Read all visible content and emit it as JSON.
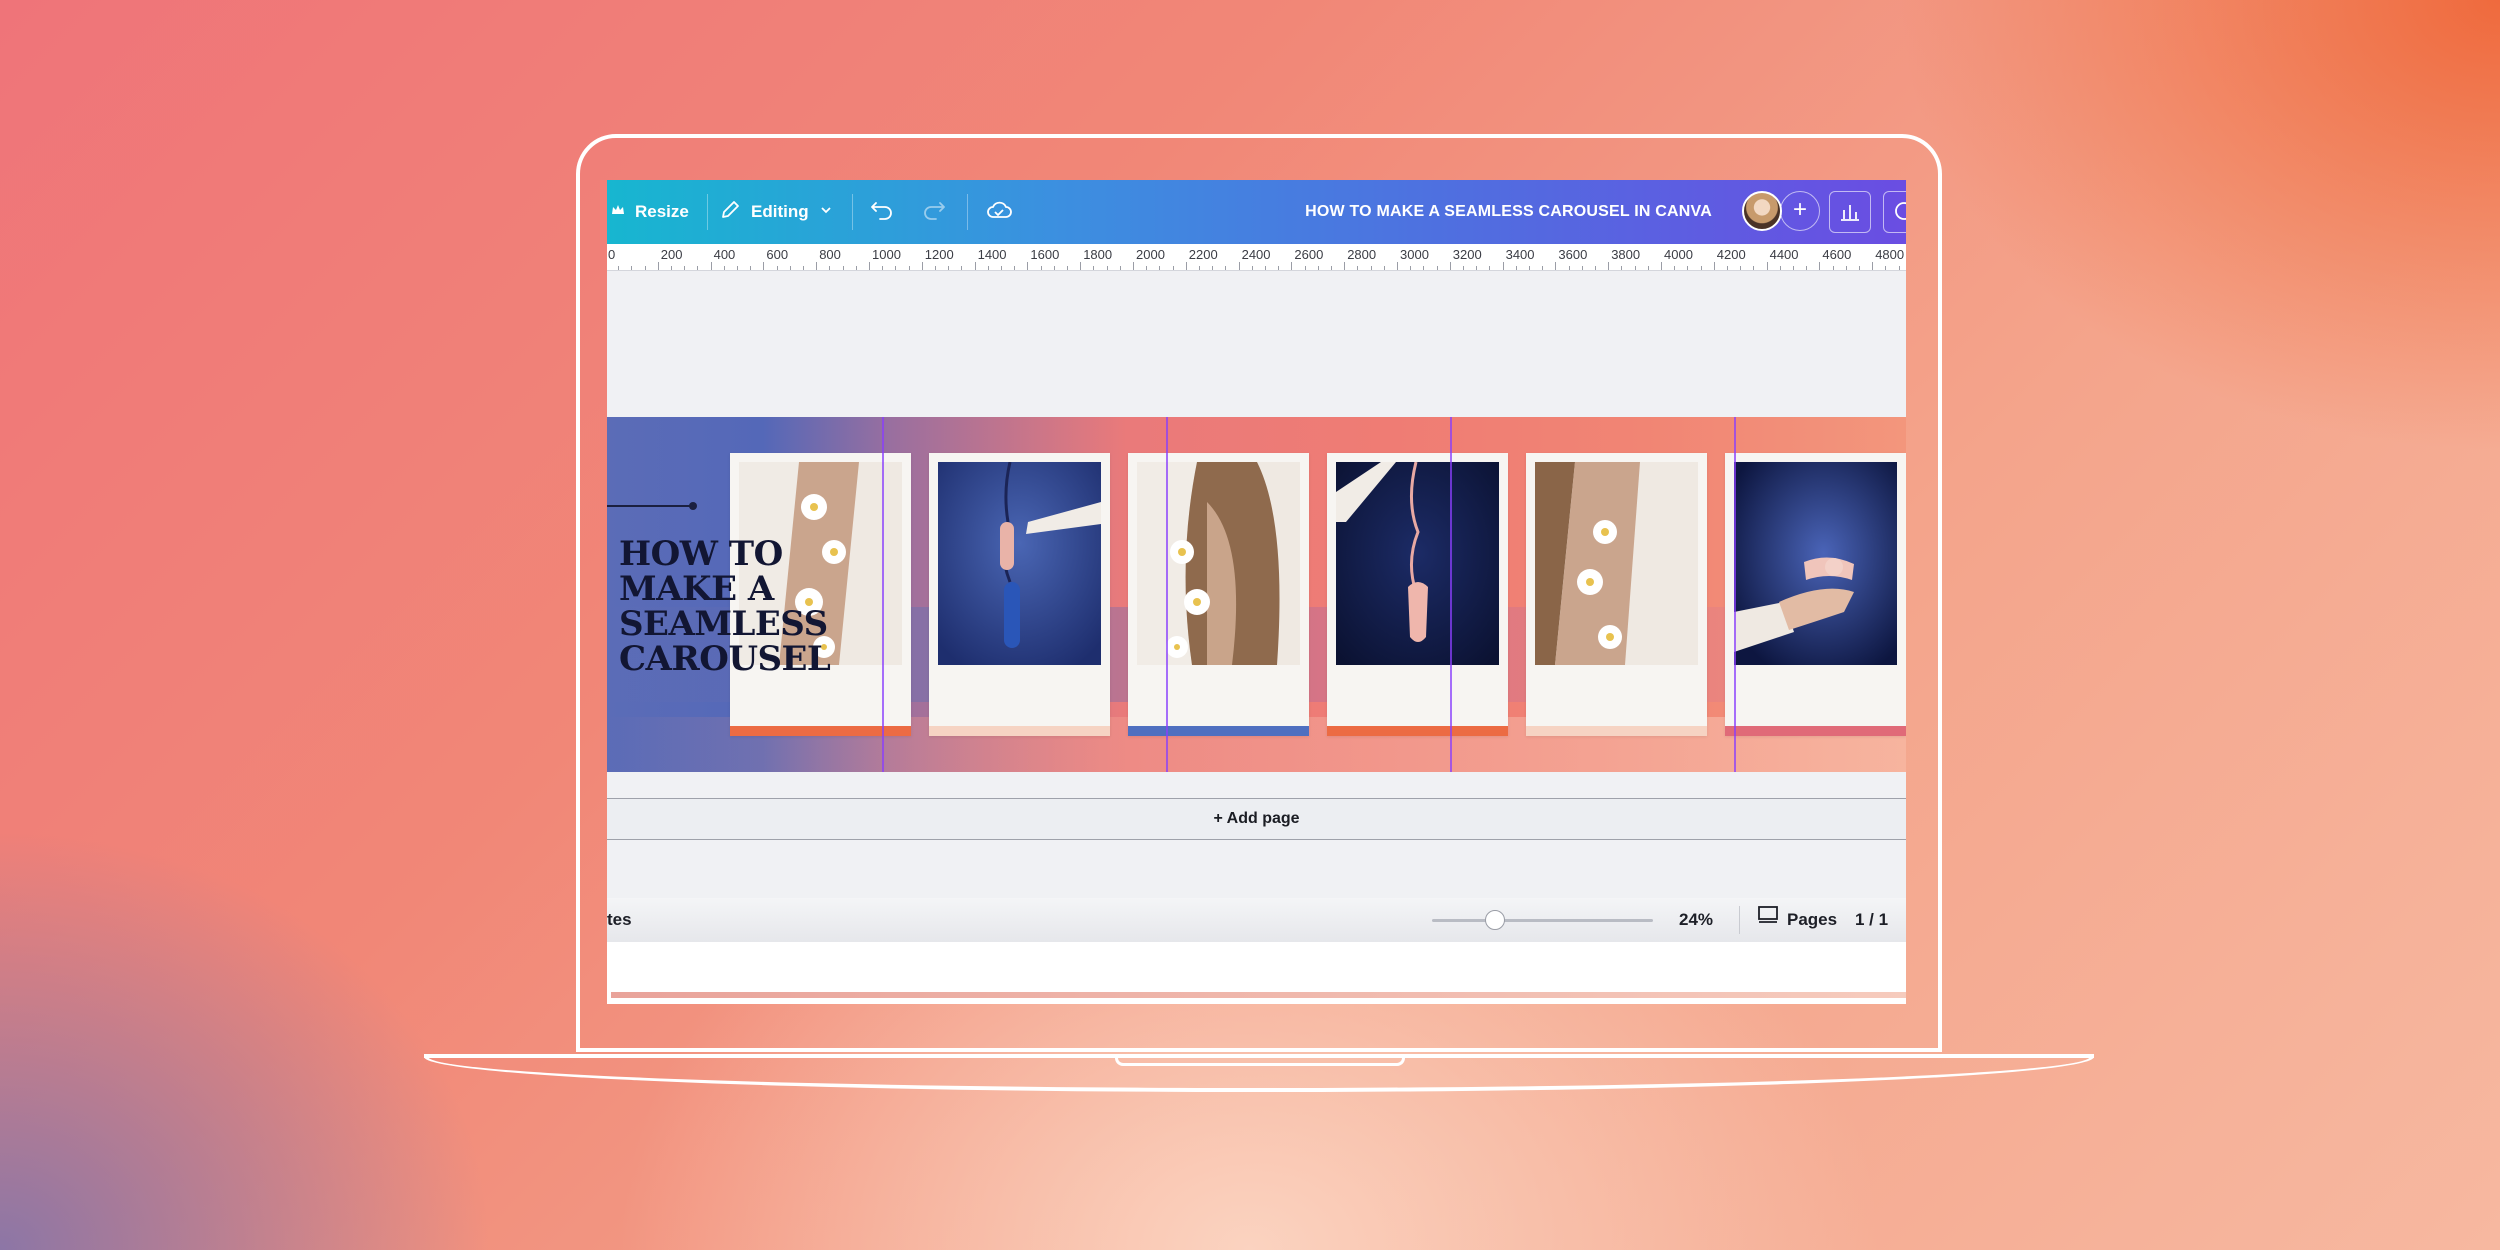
{
  "toolbar": {
    "resize_label": "Resize",
    "editing_label": "Editing",
    "document_title": "HOW TO MAKE A SEAMLESS CAROUSEL IN CANVA"
  },
  "ruler": {
    "labels": [
      "0",
      "200",
      "400",
      "600",
      "800",
      "1000",
      "1200",
      "1400",
      "1600",
      "1800",
      "2000",
      "2200",
      "2400",
      "2600",
      "2800",
      "3000",
      "3200",
      "3400",
      "3600",
      "3800",
      "4000",
      "4200",
      "4400",
      "4600",
      "4800"
    ]
  },
  "design": {
    "headline": "HOW TO\nMAKE A\nSEAMLESS\nCAROUSEL",
    "cards": [
      {
        "photo": "woman-blazer-daisies",
        "stripe_color": "#ec6b43"
      },
      {
        "photo": "blue-phone-cord",
        "stripe_color": "#f6d3c3"
      },
      {
        "photo": "woman-hair-daisies",
        "stripe_color": "#4f6fc0"
      },
      {
        "photo": "pink-phone-hanging",
        "stripe_color": "#ec6b43"
      },
      {
        "photo": "woman-blazer-daisies-2",
        "stripe_color": "#f6d3c3"
      },
      {
        "photo": "hand-holding-phone",
        "stripe_color": "#e06a78"
      }
    ]
  },
  "add_page_label": "+ Add page",
  "statusbar": {
    "notes_label": "tes",
    "zoom_value": "24%",
    "zoom_fraction": 0.24,
    "pages_label": "Pages",
    "page_count": "1 / 1"
  },
  "colors": {
    "toolbar_start": "#17b6d0",
    "toolbar_end": "#6a4de2",
    "guide_line": "#8a3ffc"
  }
}
